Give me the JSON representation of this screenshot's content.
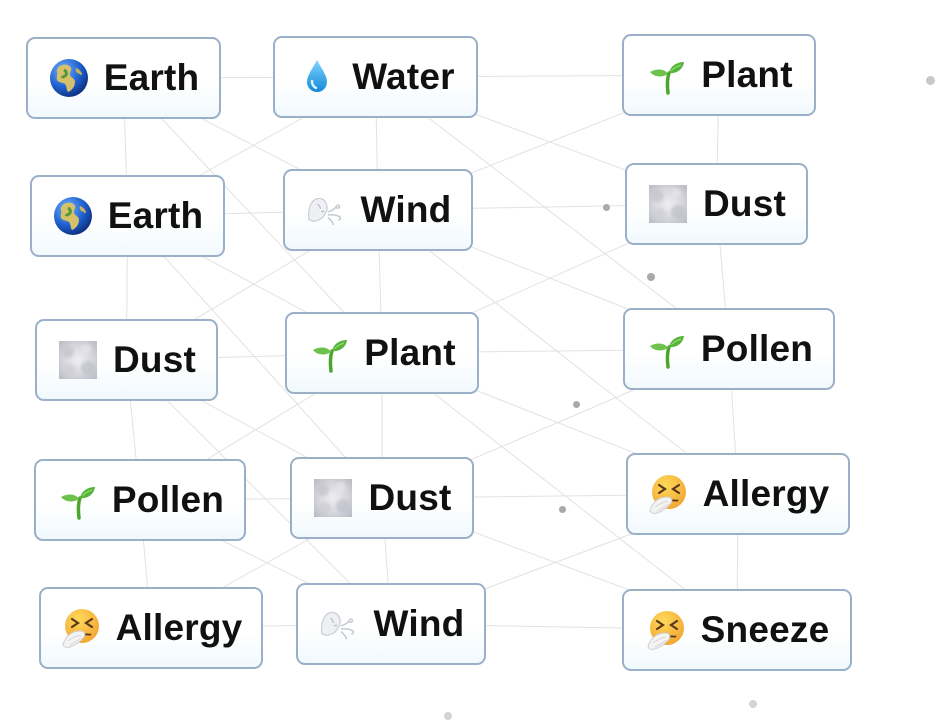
{
  "app": "Infinite Craft canvas",
  "tiles": [
    {
      "id": "earth-1",
      "label": "Earth",
      "icon": "globe-africa-icon",
      "kind": "globe"
    },
    {
      "id": "water-1",
      "label": "Water",
      "icon": "droplet-icon",
      "kind": "drop"
    },
    {
      "id": "plant-1",
      "label": "Plant",
      "icon": "seedling-icon",
      "kind": "seedling"
    },
    {
      "id": "earth-2",
      "label": "Earth",
      "icon": "globe-africa-icon",
      "kind": "globe"
    },
    {
      "id": "wind-1",
      "label": "Wind",
      "icon": "wind-face-icon",
      "kind": "wind"
    },
    {
      "id": "dust-1",
      "label": "Dust",
      "icon": "dust-cloud-icon",
      "kind": "dust"
    },
    {
      "id": "dust-2",
      "label": "Dust",
      "icon": "dust-cloud-icon",
      "kind": "dust"
    },
    {
      "id": "plant-2",
      "label": "Plant",
      "icon": "seedling-icon",
      "kind": "seedling"
    },
    {
      "id": "pollen-1",
      "label": "Pollen",
      "icon": "seedling-icon",
      "kind": "seedling"
    },
    {
      "id": "pollen-2",
      "label": "Pollen",
      "icon": "seedling-icon",
      "kind": "seedling"
    },
    {
      "id": "dust-3",
      "label": "Dust",
      "icon": "dust-cloud-icon",
      "kind": "dust"
    },
    {
      "id": "allergy-1",
      "label": "Allergy",
      "icon": "sneezing-face-icon",
      "kind": "sneeze"
    },
    {
      "id": "allergy-2",
      "label": "Allergy",
      "icon": "sneezing-face-icon",
      "kind": "sneeze"
    },
    {
      "id": "wind-2",
      "label": "Wind",
      "icon": "wind-face-icon",
      "kind": "wind"
    },
    {
      "id": "sneeze-1",
      "label": "Sneeze",
      "icon": "sneezing-face-icon",
      "kind": "sneeze"
    }
  ],
  "colors": {
    "tile_border": "#9aafc8",
    "line": "#e2e2e2",
    "dot": "#a9a9a9"
  }
}
